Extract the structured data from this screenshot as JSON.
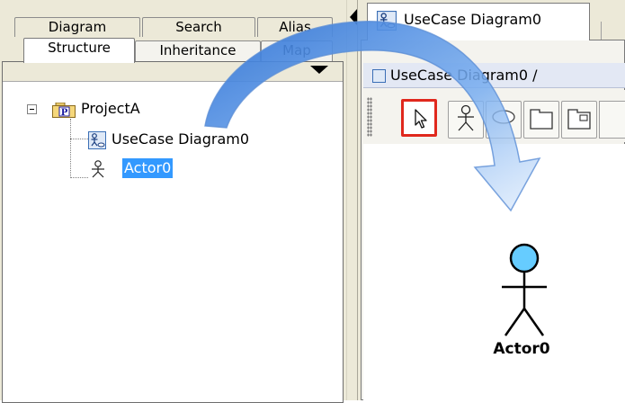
{
  "left_pane": {
    "tabs_back": [
      "Diagram",
      "Search",
      "Alias"
    ],
    "tabs_front": [
      "Structure",
      "Inheritance",
      "Map"
    ],
    "tree": {
      "project": "ProjectA",
      "project_icon_letter": "P",
      "diagram": "UseCase Diagram0",
      "actor": "Actor0"
    }
  },
  "right_pane": {
    "document_tab": "UseCase Diagram0",
    "diagram_title": "UseCase Diagram0 /",
    "toolbar_tools": [
      "select-tool",
      "actor-tool",
      "usecase-tool",
      "package-tool",
      "subsystem-tool"
    ],
    "canvas_actor_label": "Actor0"
  },
  "colors": {
    "selection": "#3399ff",
    "active_tool_border": "#e0281d",
    "actor_head": "#66ccff",
    "arrow": "#4f8ee0"
  }
}
